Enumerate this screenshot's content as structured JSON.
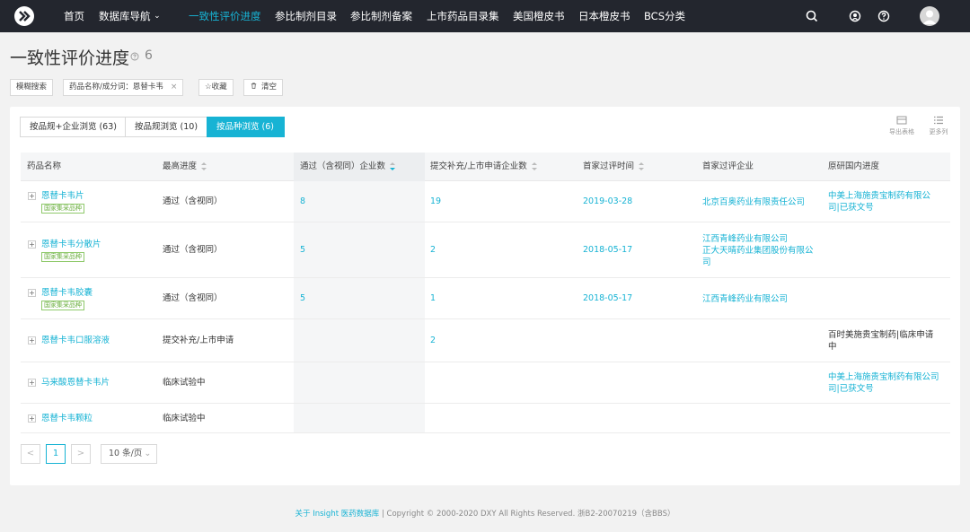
{
  "nav": {
    "items": [
      {
        "label": "首页",
        "active": false
      },
      {
        "label": "数据库导航",
        "active": false,
        "dropdown": true
      },
      {
        "label": "一致性评价进度",
        "active": true
      },
      {
        "label": "参比制剂目录",
        "active": false
      },
      {
        "label": "参比制剂备案",
        "active": false
      },
      {
        "label": "上市药品目录集",
        "active": false
      },
      {
        "label": "美国橙皮书",
        "active": false
      },
      {
        "label": "日本橙皮书",
        "active": false
      },
      {
        "label": "BCS分类",
        "active": false
      }
    ],
    "chevron": "⌄",
    "icons": [
      "search-icon",
      "notification-icon",
      "help-icon",
      "avatar"
    ],
    "accent": "#17b3d4"
  },
  "page": {
    "title": "一致性评价进度",
    "count": "6"
  },
  "filters": {
    "fuzzy_label": "模糊搜索",
    "keyword_chip": "药品名称/成分词：恩替卡韦",
    "remove": "×",
    "favorite": "☆收藏",
    "clear": "清空"
  },
  "tabs": [
    {
      "label": "按品规+企业浏览 (63)",
      "active": false
    },
    {
      "label": "按品规浏览 (10)",
      "active": false
    },
    {
      "label": "按品种浏览 (6)",
      "active": true
    }
  ],
  "tools": {
    "export": "导出表格",
    "more_columns": "更多列"
  },
  "table": {
    "headers": [
      "药品名称",
      "最高进度",
      "通过（含视同）企业数",
      "提交补充/上市申请企业数",
      "首家过评时间",
      "首家过评企业",
      "原研国内进度"
    ],
    "tag_label": "国家集采品种",
    "rows": [
      {
        "name": "恩替卡韦片",
        "tag": true,
        "progress": "通过（含视同）",
        "passed": "8",
        "submitted": "19",
        "first_date": "2019-03-28",
        "first_company": [
          "北京百奥药业有限责任公司"
        ],
        "original": [
          "中美上海施贵宝制药有限公",
          "司|已获文号"
        ],
        "original_link": true
      },
      {
        "name": "恩替卡韦分散片",
        "tag": true,
        "progress": "通过（含视同）",
        "passed": "5",
        "submitted": "2",
        "first_date": "2018-05-17",
        "first_company": [
          "江西青峰药业有限公司",
          "正大天晴药业集团股份有限公",
          "司"
        ],
        "original": [],
        "original_link": false
      },
      {
        "name": "恩替卡韦胶囊",
        "tag": true,
        "progress": "通过（含视同）",
        "passed": "5",
        "submitted": "1",
        "first_date": "2018-05-17",
        "first_company": [
          "江西青峰药业有限公司"
        ],
        "original": [],
        "original_link": false
      },
      {
        "name": "恩替卡韦口服溶液",
        "tag": false,
        "progress": "提交补充/上市申请",
        "passed": "",
        "submitted": "2",
        "first_date": "",
        "first_company": [],
        "original": [
          "百时美施贵宝制药|临床申请",
          "中"
        ],
        "original_link": false
      },
      {
        "name": "马来酸恩替卡韦片",
        "tag": false,
        "progress": "临床试验中",
        "passed": "",
        "submitted": "",
        "first_date": "",
        "first_company": [],
        "original": [
          "中美上海施贵宝制药有限公司",
          "司|已获文号"
        ],
        "original_link": true
      },
      {
        "name": "恩替卡韦颗粒",
        "tag": false,
        "progress": "临床试验中",
        "passed": "",
        "submitted": "",
        "first_date": "",
        "first_company": [],
        "original": [],
        "original_link": false
      }
    ]
  },
  "pagination": {
    "prev": "<",
    "current": "1",
    "next": ">",
    "page_size": "10 条/页"
  },
  "footer": {
    "about": "关于 Insight 医药数据库",
    "separator": " | ",
    "copyright": "Copyright © 2000-2020 DXY All Rights Reserved. 浙B2-20070219（含BBS）"
  }
}
